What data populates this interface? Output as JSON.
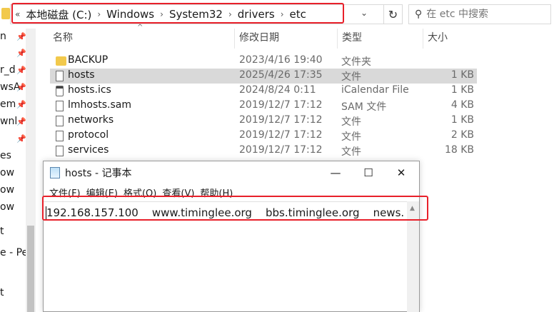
{
  "addressbar": {
    "overflow": "«",
    "crumbs": [
      "本地磁盘 (C:)",
      "Windows",
      "System32",
      "drivers",
      "etc"
    ],
    "separator": "›",
    "dropdown": "⌄",
    "refresh": "↻",
    "search_placeholder": "在 etc 中搜索"
  },
  "nav": {
    "items": [
      "n",
      "r_d",
      "wsA",
      "em",
      "wnl",
      "",
      "es",
      "ow",
      "ow",
      "ow",
      "t",
      "e - Pe",
      "",
      "t"
    ]
  },
  "columns": {
    "name": "名称",
    "date": "修改日期",
    "type": "类型",
    "size": "大小"
  },
  "files": [
    {
      "name": "BACKUP",
      "date": "2023/4/16 19:40",
      "type": "文件夹",
      "size": "",
      "icon": "folder-icon"
    },
    {
      "name": "hosts",
      "date": "2025/4/26 17:35",
      "type": "文件",
      "size": "1 KB",
      "icon": "file-icon",
      "selected": true
    },
    {
      "name": "hosts.ics",
      "date": "2024/8/24 0:11",
      "type": "iCalendar File",
      "size": "1 KB",
      "icon": "calendar-file-icon"
    },
    {
      "name": "lmhosts.sam",
      "date": "2019/12/7 17:12",
      "type": "SAM 文件",
      "size": "4 KB",
      "icon": "file-icon"
    },
    {
      "name": "networks",
      "date": "2019/12/7 17:12",
      "type": "文件",
      "size": "1 KB",
      "icon": "file-icon"
    },
    {
      "name": "protocol",
      "date": "2019/12/7 17:12",
      "type": "文件",
      "size": "2 KB",
      "icon": "file-icon"
    },
    {
      "name": "services",
      "date": "2019/12/7 17:12",
      "type": "文件",
      "size": "18 KB",
      "icon": "file-icon"
    }
  ],
  "notepad": {
    "title": "hosts - 记事本",
    "menu": [
      "文件(F)",
      "编辑(E)",
      "格式(O)",
      "查看(V)",
      "帮助(H)"
    ],
    "line": "192.168.157.100    www.timinglee.org    bbs.timinglee.org    news.",
    "minimize": "—",
    "maximize": "☐",
    "close": "✕"
  },
  "colors": {
    "highlight": "#e8202a",
    "selection": "#d9d9d9",
    "folder": "#f2c94c"
  }
}
